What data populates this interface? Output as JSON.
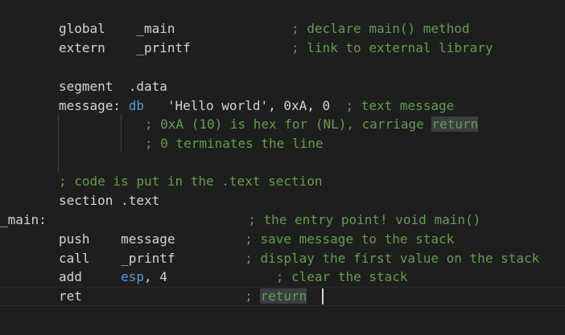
{
  "editor": {
    "theme": {
      "background": "#1e1e1e",
      "text": "#d4d4d4",
      "comment": "#6a9955",
      "keyword": "#569cd6",
      "highlight_bg": "#3a3d41"
    },
    "lines": [
      {
        "indent": "       ",
        "segments": [
          {
            "text": "global",
            "cls": "c-default"
          },
          {
            "text": "    _main",
            "cls": "c-default"
          },
          {
            "text": "               ; declare main() method",
            "cls": "c-comment"
          }
        ]
      },
      {
        "indent": "       ",
        "segments": [
          {
            "text": "extern",
            "cls": "c-default"
          },
          {
            "text": "    _printf",
            "cls": "c-default"
          },
          {
            "text": "             ; link to external library",
            "cls": "c-comment"
          }
        ]
      },
      {
        "indent": "",
        "segments": []
      },
      {
        "indent": "       ",
        "segments": [
          {
            "text": "segment  .data",
            "cls": "c-default"
          }
        ]
      },
      {
        "indent": "       ",
        "segments": [
          {
            "text": "message: ",
            "cls": "c-default"
          },
          {
            "text": "db",
            "cls": "c-keyword"
          },
          {
            "text": "   'Hello world', ",
            "cls": "c-default"
          },
          {
            "text": "0xA",
            "cls": "c-default"
          },
          {
            "text": ", ",
            "cls": "c-default"
          },
          {
            "text": "0",
            "cls": "c-default"
          },
          {
            "text": "  ; text message",
            "cls": "c-comment"
          }
        ]
      },
      {
        "indent": "               ",
        "segments": [
          {
            "text": "   ; 0xA (10) is hex for (NL), carriage ",
            "cls": "c-comment"
          },
          {
            "text": "return",
            "cls": "word-highlight"
          }
        ]
      },
      {
        "indent": "               ",
        "segments": [
          {
            "text": "   ; 0 terminates the line",
            "cls": "c-comment"
          }
        ]
      },
      {
        "indent": "",
        "segments": []
      },
      {
        "indent": "       ",
        "segments": [
          {
            "text": "; code is put in the .text section",
            "cls": "c-comment"
          }
        ]
      },
      {
        "indent": "       ",
        "segments": [
          {
            "text": "section .text",
            "cls": "c-default"
          }
        ]
      },
      {
        "indent": "",
        "segments": [
          {
            "text": "_main:",
            "cls": "c-default"
          },
          {
            "text": "                          ; the entry point! void main()",
            "cls": "c-comment"
          }
        ]
      },
      {
        "indent": "       ",
        "segments": [
          {
            "text": "push",
            "cls": "c-default"
          },
          {
            "text": "    message",
            "cls": "c-default"
          },
          {
            "text": "         ; save message to the stack",
            "cls": "c-comment"
          }
        ]
      },
      {
        "indent": "       ",
        "segments": [
          {
            "text": "call",
            "cls": "c-default"
          },
          {
            "text": "    _printf",
            "cls": "c-default"
          },
          {
            "text": "         ; display the first value on the stack",
            "cls": "c-comment"
          }
        ]
      },
      {
        "indent": "       ",
        "segments": [
          {
            "text": "add",
            "cls": "c-default"
          },
          {
            "text": "     ",
            "cls": "c-default"
          },
          {
            "text": "esp",
            "cls": "c-keyword"
          },
          {
            "text": ", 4",
            "cls": "c-default"
          },
          {
            "text": "              ; clear the stack",
            "cls": "c-comment"
          }
        ]
      },
      {
        "indent": "       ",
        "segments": [
          {
            "text": "ret",
            "cls": "c-default"
          },
          {
            "text": "                     ; ",
            "cls": "c-comment"
          },
          {
            "text": "return",
            "cls": "word-highlight"
          }
        ]
      }
    ]
  }
}
